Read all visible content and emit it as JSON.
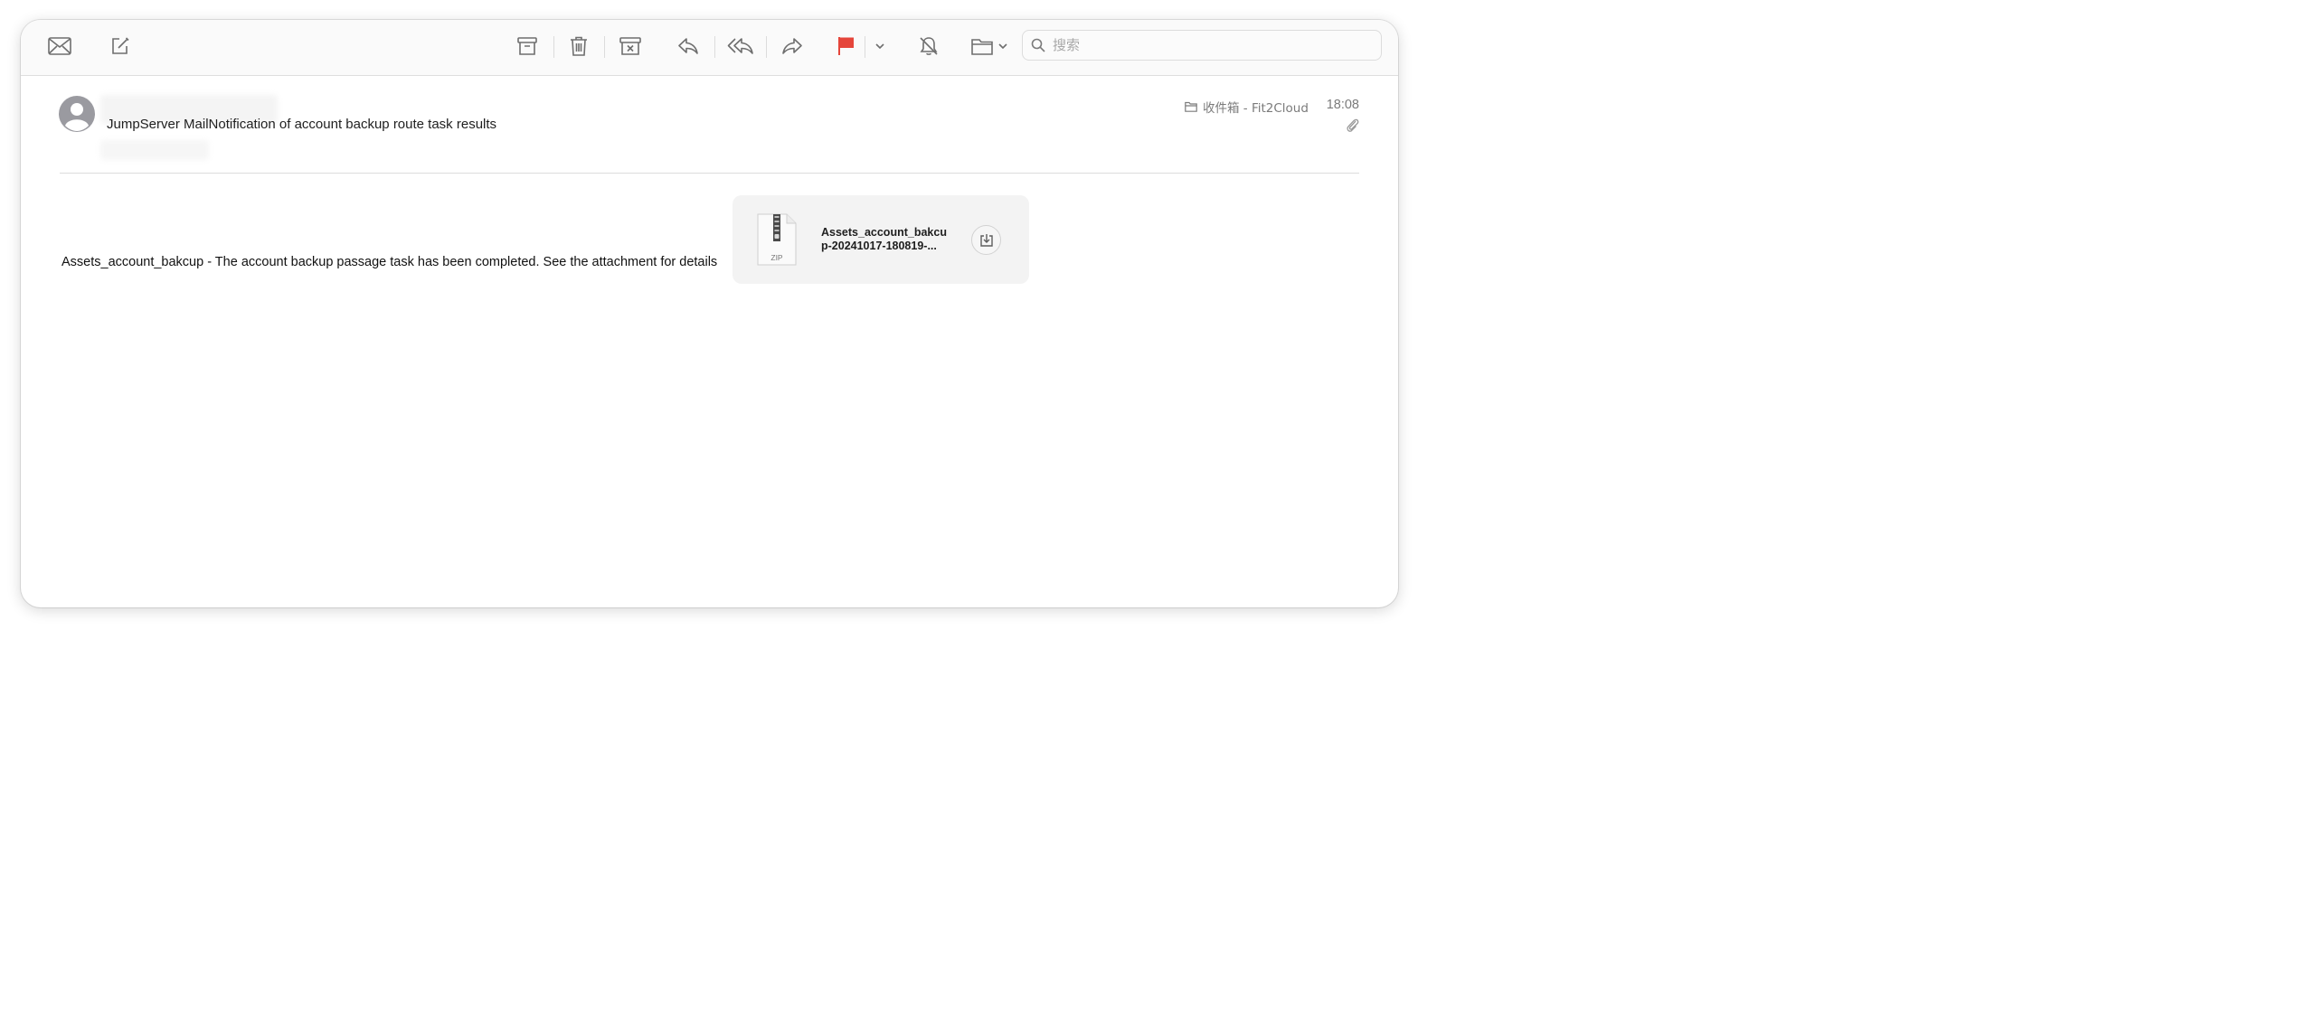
{
  "toolbar": {
    "buttons": [
      {
        "name": "get-mail",
        "icon": "envelope-icon"
      },
      {
        "name": "compose",
        "icon": "compose-icon"
      },
      {
        "name": "archive",
        "icon": "archive-icon"
      },
      {
        "name": "delete",
        "icon": "trash-icon"
      },
      {
        "name": "junk",
        "icon": "junk-icon"
      },
      {
        "name": "reply",
        "icon": "reply-icon"
      },
      {
        "name": "reply-all",
        "icon": "reply-all-icon"
      },
      {
        "name": "forward",
        "icon": "forward-icon"
      },
      {
        "name": "flag",
        "icon": "flag-icon",
        "color": "#e5453a"
      },
      {
        "name": "mute",
        "icon": "bell-slash-icon"
      },
      {
        "name": "move",
        "icon": "folder-icon"
      }
    ],
    "search_placeholder": "搜索",
    "search_value": ""
  },
  "message": {
    "subject": "JumpServer MailNotification of account backup route task results",
    "mailbox": "收件箱 - Fit2Cloud",
    "time": "18:08",
    "body": "Assets_account_bakcup - The account backup passage task has been completed. See the attachment for details"
  },
  "attachment": {
    "type_label": "ZIP",
    "name_line1": "Assets_account_bakcu",
    "name_line2": "p-20241017-180819-..."
  },
  "colors": {
    "flag": "#e5453a",
    "icon": "#6e6e6e"
  }
}
